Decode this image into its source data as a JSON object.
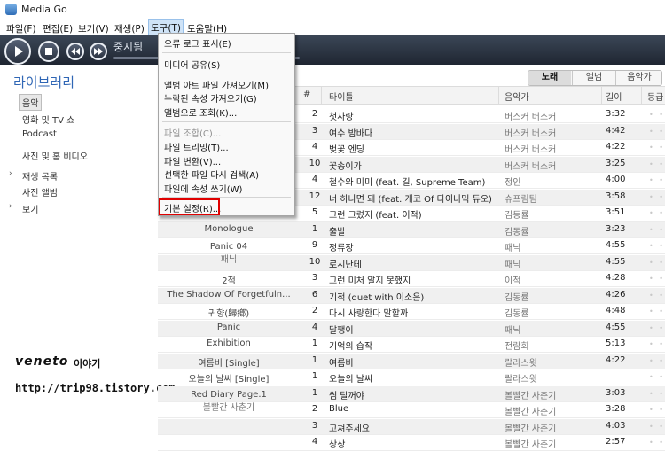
{
  "app": {
    "title": "Media Go"
  },
  "menubar": [
    {
      "label": "파일(F)"
    },
    {
      "label": "편집(E)"
    },
    {
      "label": "보기(V)"
    },
    {
      "label": "재생(P)"
    },
    {
      "label": "도구(T)"
    },
    {
      "label": "도움말(H)"
    }
  ],
  "player": {
    "status": "중지됨"
  },
  "sidebar": {
    "title": "라이브러리",
    "items": [
      {
        "label": "음악"
      },
      {
        "label": "영화 및 TV 쇼"
      },
      {
        "label": "Podcast"
      },
      {
        "label": "사진 및 홈 비디오"
      },
      {
        "label": "재생 목록"
      },
      {
        "label": "사진 앨범"
      },
      {
        "label": "보기"
      }
    ],
    "caret": "›",
    "brand_name": "veneto",
    "brand_suffix": "이야기",
    "brand_url": "http://trip98.tistory.com"
  },
  "view_tabs": [
    {
      "label": "노래"
    },
    {
      "label": "앨범"
    },
    {
      "label": "음악가"
    }
  ],
  "table": {
    "headers": {
      "num": "#",
      "title": "타이틀",
      "artist": "음악가",
      "length": "길이",
      "rating": "등급"
    },
    "rating_glyph": "• • •",
    "rows": [
      {
        "num": "2",
        "title": "첫사랑",
        "artist": "버스커 버스커",
        "length": "3:32"
      },
      {
        "num": "3",
        "title": "여수 밤바다",
        "artist": "버스커 버스커",
        "length": "4:42"
      },
      {
        "num": "4",
        "title": "벚꽃 엔딩",
        "artist": "버스커 버스커",
        "length": "4:22"
      },
      {
        "num": "10",
        "title": "꽃송이가",
        "artist": "버스커 버스커",
        "length": "3:25"
      },
      {
        "num": "4",
        "title": "철수와 미미 (feat. 길, Supreme Team)",
        "artist": "정인",
        "length": "4:00"
      },
      {
        "num": "12",
        "title": "너 하나면 돼 (feat. 개코 Of 다이나믹 듀오)",
        "artist": "슈프림팀",
        "length": "3:58"
      },
      {
        "num": "5",
        "title": "그런 그렀지 (feat. 이적)",
        "artist": "김동률",
        "length": "3:51"
      },
      {
        "num": "1",
        "title": "출발",
        "artist": "김동률",
        "length": "3:23"
      },
      {
        "num": "9",
        "title": "정류장",
        "artist": "패닉",
        "length": "4:55"
      },
      {
        "num": "10",
        "title": "로시난테",
        "artist": "패닉",
        "length": "4:55"
      },
      {
        "num": "3",
        "title": "그런 미처 알지 못했지",
        "artist": "이적",
        "length": "4:28"
      },
      {
        "num": "6",
        "title": "기적 (duet with 이소은)",
        "artist": "김동률",
        "length": "4:26"
      },
      {
        "num": "2",
        "title": "다시 사랑한다 말할까",
        "artist": "김동률",
        "length": "4:48"
      },
      {
        "num": "4",
        "title": "달팽이",
        "artist": "패닉",
        "length": "4:55"
      },
      {
        "num": "1",
        "title": "기억의 습작",
        "artist": "전람회",
        "length": "5:13"
      },
      {
        "num": "1",
        "title": "여름비",
        "artist": "랄라스윗",
        "length": "4:22"
      },
      {
        "num": "1",
        "title": "오늘의 날씨",
        "artist": "랄라스윗",
        "length": ""
      },
      {
        "num": "1",
        "title": "썸 탈꺼야",
        "artist": "볼빨간 사춘기",
        "length": "3:03"
      },
      {
        "num": "2",
        "title": "Blue",
        "artist": "볼빨간 사춘기",
        "length": "3:28"
      },
      {
        "num": "3",
        "title": "고쳐주세요",
        "artist": "볼빨간 사춘기",
        "length": "4:03"
      },
      {
        "num": "4",
        "title": "상상",
        "artist": "볼빨간 사춘기",
        "length": "2:57"
      }
    ],
    "albums": [
      {
        "title": "Monologue",
        "sub": ""
      },
      {
        "title": "Panic 04",
        "sub": "패닉"
      },
      {
        "title": "2적",
        "sub": ""
      },
      {
        "title": "The Shadow Of Forgetfuln...",
        "sub": ""
      },
      {
        "title": "귀향(歸鄕)",
        "sub": ""
      },
      {
        "title": "Panic",
        "sub": ""
      },
      {
        "title": "Exhibition",
        "sub": ""
      },
      {
        "title": "여름비 [Single]",
        "sub": ""
      },
      {
        "title": "오늘의 날씨 [Single]",
        "sub": ""
      },
      {
        "title": "Red Diary Page.1",
        "sub": "볼빨간 사춘기"
      }
    ]
  },
  "dropdown": {
    "items": [
      {
        "label": "오류 로그 표시(E)",
        "enabled": true
      },
      {
        "label": "미디어 공유(S)",
        "enabled": true
      },
      {
        "label": "앨범 아트 파일 가져오기(M)",
        "enabled": true
      },
      {
        "label": "누락된 속성 가져오기(G)",
        "enabled": true
      },
      {
        "label": "앨범으로 조회(K)...",
        "enabled": true
      },
      {
        "label": "파일 조합(C)...",
        "enabled": false
      },
      {
        "label": "파일 트리밍(T)...",
        "enabled": true
      },
      {
        "label": "파일 변환(V)...",
        "enabled": true
      },
      {
        "label": "선택한 파일 다시 검색(A)",
        "enabled": true
      },
      {
        "label": "파일에 속성 쓰기(W)",
        "enabled": true
      },
      {
        "label": "기본 설정(R)...",
        "enabled": true
      }
    ]
  },
  "colors": {
    "accent": "#2f66b5",
    "highlight_box": "#e00000",
    "player_bg": "#2a3240"
  }
}
